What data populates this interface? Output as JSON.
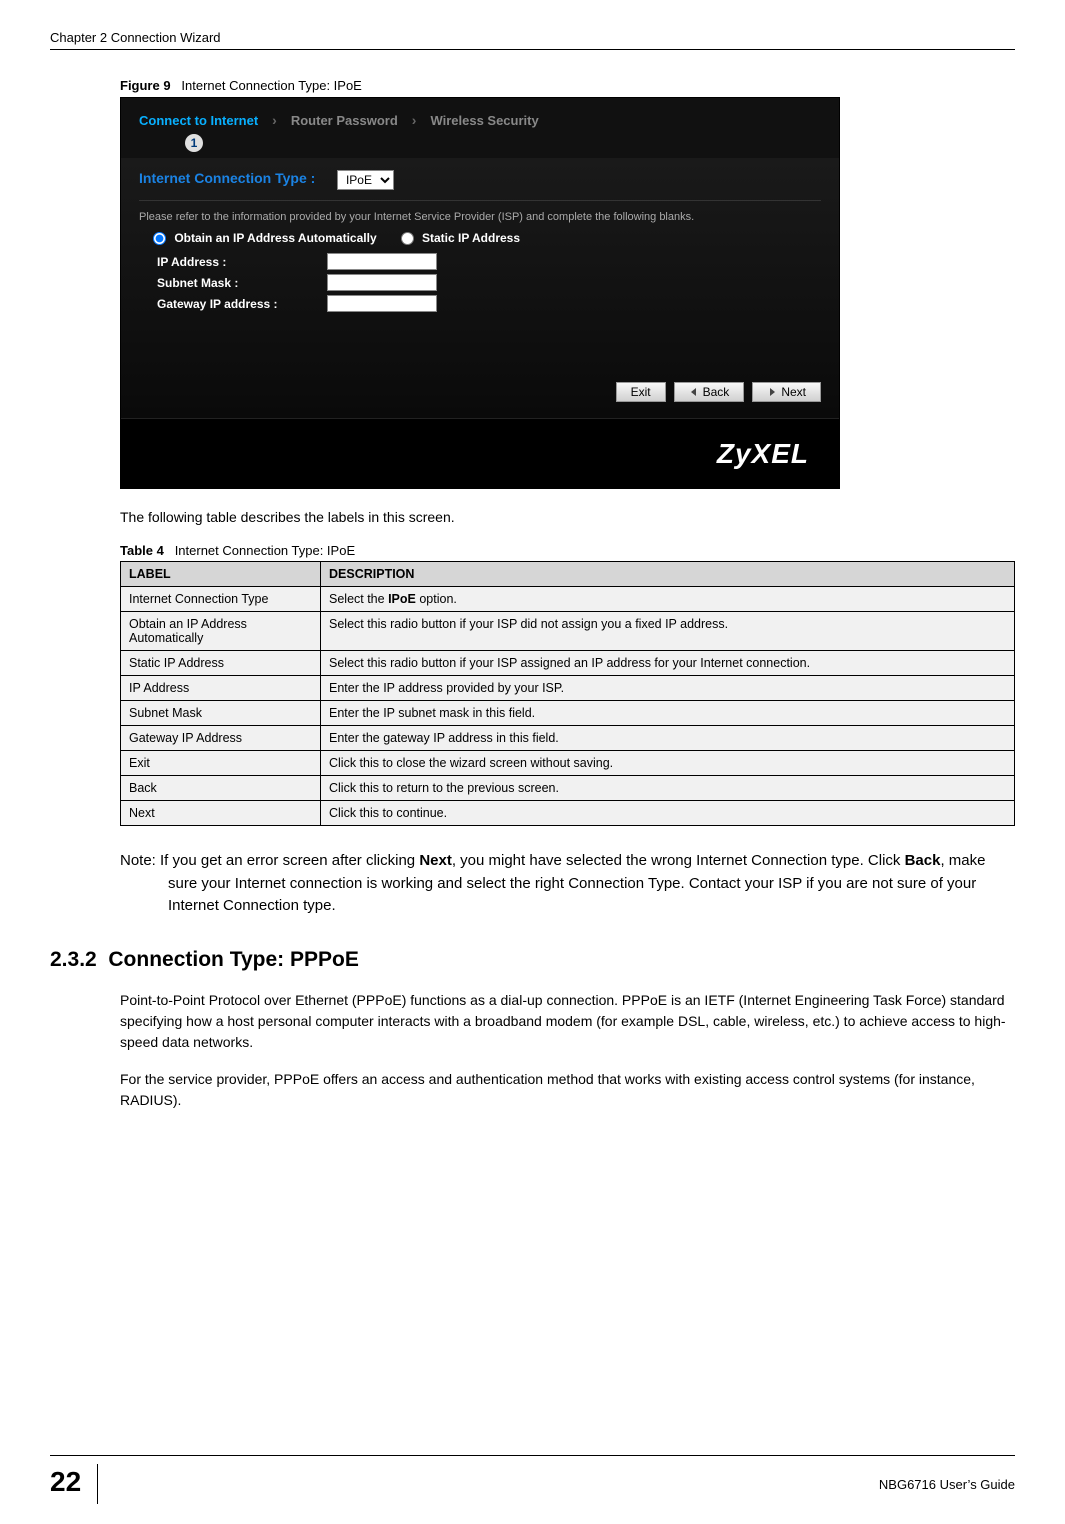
{
  "header": {
    "chapter": "Chapter 2 Connection Wizard"
  },
  "figure": {
    "label": "Figure 9",
    "title": "Internet Connection Type: IPoE"
  },
  "screenshot": {
    "steps": {
      "s1": "Connect to Internet",
      "s2": "Router Password",
      "s3": "Wireless Security",
      "active_num": "1"
    },
    "conn_type_label": "Internet Connection Type :",
    "conn_type_value": "IPoE",
    "hint": "Please refer to the information provided by your Internet Service Provider (ISP) and complete the following blanks.",
    "radio1": "Obtain an IP Address Automatically",
    "radio2": "Static IP Address",
    "fields": {
      "ip": "IP Address :",
      "subnet": "Subnet Mask :",
      "gw": "Gateway IP address :"
    },
    "btns": {
      "exit": "Exit",
      "back": "Back",
      "next": "Next"
    },
    "brand": "ZyXEL"
  },
  "intro_text": "The following table describes the labels in this screen.",
  "table": {
    "label": "Table 4",
    "title": "Internet Connection Type: IPoE",
    "head": {
      "c1": "LABEL",
      "c2": "DESCRIPTION"
    },
    "rows": [
      {
        "l": "Internet Connection Type",
        "d_pre": "Select the ",
        "d_bold": "IPoE",
        "d_post": " option."
      },
      {
        "l": "Obtain an IP Address Automatically",
        "d": "Select this radio button if your ISP did not assign you a fixed IP address."
      },
      {
        "l": "Static IP Address",
        "d": "Select this radio button if your ISP assigned an IP address for your Internet connection."
      },
      {
        "l": "IP Address",
        "d": "Enter the IP address provided by your ISP."
      },
      {
        "l": "Subnet Mask",
        "d": "Enter the IP subnet mask in this field."
      },
      {
        "l": "Gateway IP Address",
        "d": "Enter the gateway IP address in this field."
      },
      {
        "l": "Exit",
        "d": "Click this to close the wizard screen without saving."
      },
      {
        "l": "Back",
        "d": "Click this to return to the previous screen."
      },
      {
        "l": "Next",
        "d": "Click this to continue."
      }
    ]
  },
  "note": {
    "pre": "Note: If you get an error screen after clicking ",
    "b1": "Next",
    "mid1": ", you might have selected the wrong Internet Connection type. Click ",
    "b2": "Back",
    "post": ", make sure your Internet connection is working and select the right Connection Type. Contact your ISP if you are not sure of your Internet Connection type."
  },
  "section": {
    "num": "2.3.2",
    "title": "Connection Type: PPPoE"
  },
  "para1": "Point-to-Point Protocol over Ethernet (PPPoE) functions as a dial-up connection. PPPoE is an IETF (Internet Engineering Task Force) standard specifying how a host personal computer interacts with a broadband modem (for example DSL, cable, wireless, etc.) to achieve access to high-speed data networks.",
  "para2": "For the service provider, PPPoE offers an access and authentication method that works with existing access control systems (for instance, RADIUS).",
  "footer": {
    "page": "22",
    "guide": "NBG6716 User’s Guide"
  }
}
